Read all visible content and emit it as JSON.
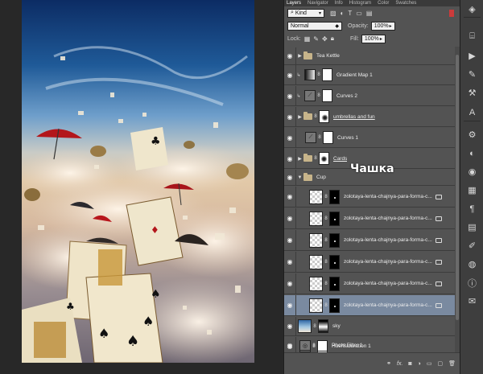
{
  "panel": {
    "tabs": [
      "Layers",
      "Navigator",
      "Info",
      "Histogram",
      "Color",
      "Swatches"
    ],
    "filter_kind": "Kind",
    "blend_mode": "Normal",
    "opacity_label": "Opacity:",
    "opacity_value": "100%",
    "lock_label": "Lock:",
    "fill_label": "Fill:",
    "fill_value": "100%"
  },
  "annotation": "Чашка",
  "layers": [
    {
      "name": "Tea Kettle",
      "kind": "group"
    },
    {
      "name": "Gradient Map 1",
      "kind": "gradient"
    },
    {
      "name": "Curves 2",
      "kind": "curves"
    },
    {
      "name": "umbrellas and fun",
      "kind": "group-mask"
    },
    {
      "name": "Curves 1",
      "kind": "curves"
    },
    {
      "name": "Cards",
      "kind": "group-mask"
    },
    {
      "name": "Cup",
      "kind": "group-open"
    },
    {
      "name": "zolotaya-lenta-chajnya-para-forma-c...",
      "kind": "smart"
    },
    {
      "name": "zolotaya-lenta-chajnya-para-forma-c...",
      "kind": "smart"
    },
    {
      "name": "zolotaya-lenta-chajnya-para-forma-c...",
      "kind": "smart"
    },
    {
      "name": "zolotaya-lenta-chajnya-para-forma-c...",
      "kind": "smart"
    },
    {
      "name": "zolotaya-lenta-chajnya-para-forma-c...",
      "kind": "smart"
    },
    {
      "name": "zolotaya-lenta-chajnya-para-forma-c...",
      "kind": "smart"
    },
    {
      "name": "sky",
      "kind": "image"
    },
    {
      "name": "Hue/Saturation 1",
      "kind": "huesat"
    },
    {
      "name": "Photo Filter 1",
      "kind": "photofilter"
    }
  ],
  "icons": [
    "eye-icon",
    "folder-icon",
    "chain-link-icon",
    "smart-object-icon",
    "lock-icon",
    "fx-icon",
    "new-layer-icon",
    "trash-icon"
  ]
}
